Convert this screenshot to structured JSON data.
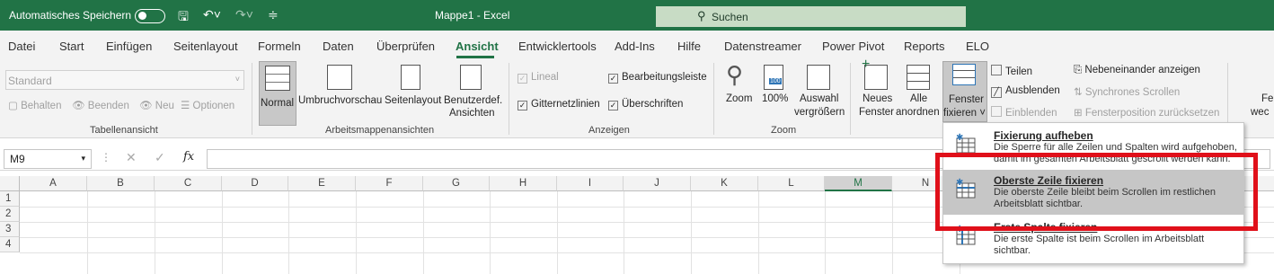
{
  "title": {
    "autosave": "Automatisches Speichern",
    "doc": "Mappe1 - Excel",
    "search": "Suchen"
  },
  "tabs": [
    "Datei",
    "Start",
    "Einfügen",
    "Seitenlayout",
    "Formeln",
    "Daten",
    "Überprüfen",
    "Ansicht",
    "Entwicklertools",
    "Add-Ins",
    "Hilfe",
    "Datenstreamer",
    "Power Pivot",
    "Reports",
    "ELO"
  ],
  "ribbon": {
    "sheetview": {
      "select": "Standard",
      "keep": "Behalten",
      "exit": "Beenden",
      "new": "Neu",
      "options": "Optionen",
      "group": "Tabellenansicht"
    },
    "workbookviews": {
      "normal": "Normal",
      "pagebreak": "Umbruchvorschau",
      "pagelayout": "Seitenlayout",
      "custom1": "Benutzerdef.",
      "custom2": "Ansichten",
      "group": "Arbeitsmappenansichten"
    },
    "show": {
      "ruler": "Lineal",
      "formulabar": "Bearbeitungsleiste",
      "gridlines": "Gitternetzlinien",
      "headings": "Überschriften",
      "group": "Anzeigen"
    },
    "zoom": {
      "zoom": "Zoom",
      "hundred": "100%",
      "sel1": "Auswahl",
      "sel2": "vergrößern",
      "group": "Zoom"
    },
    "window": {
      "new1": "Neues",
      "new2": "Fenster",
      "all1": "Alle",
      "all2": "anordnen",
      "freeze1": "Fenster",
      "freeze2": "fixieren ˅",
      "split": "Teilen",
      "hide": "Ausblenden",
      "unhide": "Einblenden",
      "side": "Nebeneinander anzeigen",
      "sync": "Synchrones Scrollen",
      "reset": "Fensterposition zurücksetzen",
      "wecIcon": "Fe",
      "wecText": "wec"
    }
  },
  "formula": {
    "namebox": "M9",
    "fx": "fx"
  },
  "columns": [
    "A",
    "B",
    "C",
    "D",
    "E",
    "F",
    "G",
    "H",
    "I",
    "J",
    "K",
    "L",
    "M",
    "N"
  ],
  "rows": [
    "1",
    "2",
    "3",
    "4"
  ],
  "menu": [
    {
      "title": "Fixierung aufheben",
      "desc": "Die Sperre für alle Zeilen und Spalten wird aufgehoben, damit im gesamten Arbeitsblatt gescrollt werden kann."
    },
    {
      "title": "Oberste Zeile fixieren",
      "desc": "Die oberste Zeile bleibt beim Scrollen im restlichen Arbeitsblatt sichtbar."
    },
    {
      "title": "Erste Spalte fixieren",
      "desc": "Die erste Spalte ist beim Scrollen im Arbeitsblatt sichtbar."
    }
  ],
  "colors": {
    "excel_green": "#217346",
    "highlight": "#e0101a"
  }
}
